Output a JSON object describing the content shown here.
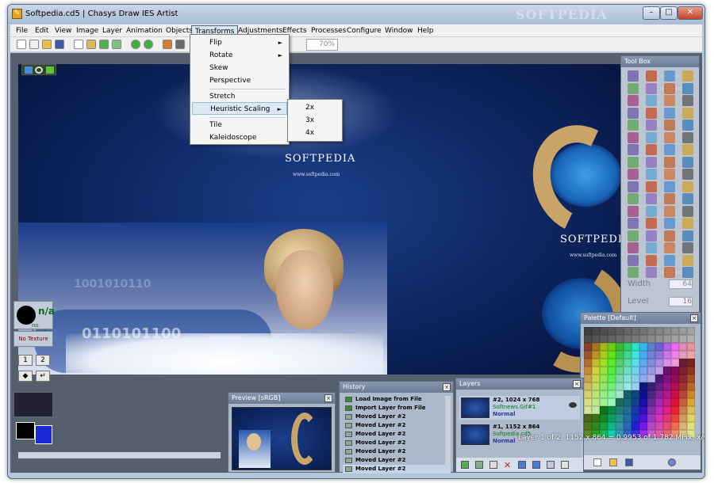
{
  "window": {
    "title": "Softpedia.cd5 | Chasys Draw IES Artist",
    "watermark": "SOFTPEDIA"
  },
  "window_buttons": {
    "minimize": "–",
    "maximize": "□",
    "close": "✕"
  },
  "menubar": [
    "File",
    "Edit",
    "View",
    "Image",
    "Layer",
    "Animation",
    "Objects",
    "Transforms",
    "Adjustments",
    "Effects",
    "Processes",
    "Configure",
    "Window",
    "Help"
  ],
  "toolbar": {
    "zoom": "70%"
  },
  "transforms_menu": {
    "items": [
      "Flip",
      "Rotate",
      "Skew",
      "Perspective",
      "Stretch",
      "Heuristic Scaling",
      "Tile",
      "Kaleidoscope"
    ],
    "arrow": "►"
  },
  "heuristic_submenu": [
    "2x",
    "3x",
    "4x"
  ],
  "canvas": {
    "logo_1": "SOFTPEDIA",
    "url_1": "www.softpedia.com",
    "logo_2": "SOFTPEDIA",
    "url_2": "www.softpedia.com",
    "numbers": "1001010110",
    "numbers_2": "0110101100"
  },
  "toolbox": {
    "title": "Tool Box",
    "width_label": "Width",
    "width_value": "64",
    "level_label": "Level",
    "level_value": "16"
  },
  "left_panel": {
    "brush_value": "n/a",
    "brush_label": "no brush",
    "texture": "No Texture",
    "buttons": [
      "1",
      "2",
      "◆",
      "↵"
    ]
  },
  "palette": {
    "title": "Palette [Default]"
  },
  "preview": {
    "title": "Preview [sRGB]"
  },
  "history": {
    "title": "History",
    "items": [
      "Load Image from File",
      "Import Layer from File",
      "Moved Layer #2",
      "Moved Layer #2",
      "Moved Layer #2",
      "Moved Layer #2",
      "Moved Layer #2",
      "Moved Layer #2",
      "Moved Layer #2"
    ]
  },
  "layers": {
    "title": "Layers",
    "items": [
      {
        "name": "#2, 1024 x 768",
        "source": "Softnews.Gif#1",
        "mode": "Normal"
      },
      {
        "name": "#1, 1152 x 864",
        "source": "Softpedia.cd5",
        "mode": "Normal"
      }
    ]
  },
  "status": "Layer 1 of 2, 1152 x 864 = 0.9953 of 1.782 MPix, x/y=4:3"
}
